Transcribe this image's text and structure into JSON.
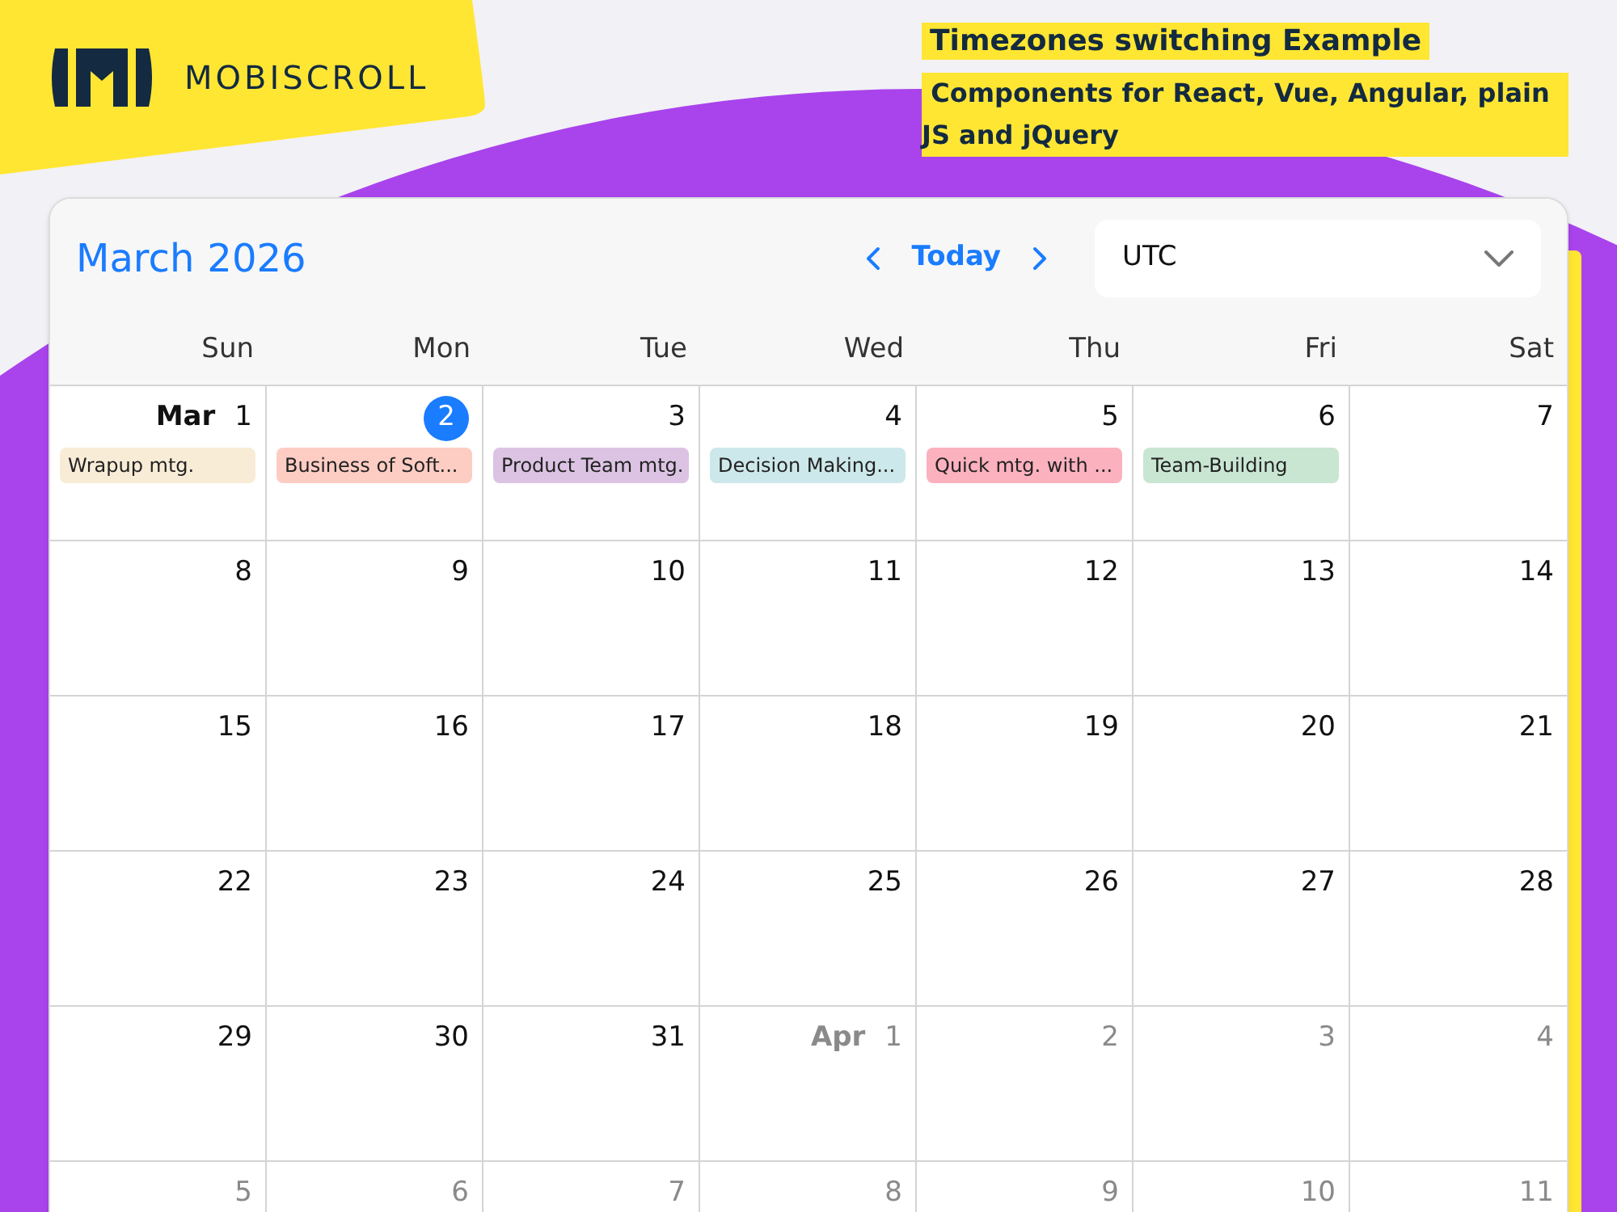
{
  "brand": {
    "name": "MOBISCROLL"
  },
  "heading": {
    "title": "Timezones switching Example",
    "subtitle": " Components for React, Vue, Angular, plain JS and jQuery"
  },
  "calendar": {
    "month": "March",
    "year": "2026",
    "today_button": "Today",
    "timezone": {
      "value": "UTC"
    },
    "weekdays": [
      "Sun",
      "Mon",
      "Tue",
      "Wed",
      "Thu",
      "Fri",
      "Sat"
    ],
    "weeks": [
      [
        {
          "month_label": "Mar",
          "day": "1",
          "outside": false,
          "selected": false,
          "events": [
            {
              "title": "Wrapup mtg.",
              "color": "#f8ecd6"
            }
          ]
        },
        {
          "day": "2",
          "outside": false,
          "selected": true,
          "events": [
            {
              "title": "Business of Soft...",
              "color": "#fdcdc3"
            }
          ]
        },
        {
          "day": "3",
          "outside": false,
          "selected": false,
          "events": [
            {
              "title": "Product Team mtg.",
              "color": "#dcc3e3"
            }
          ]
        },
        {
          "day": "4",
          "outside": false,
          "selected": false,
          "events": [
            {
              "title": "Decision Making...",
              "color": "#cde8ea"
            }
          ]
        },
        {
          "day": "5",
          "outside": false,
          "selected": false,
          "events": [
            {
              "title": "Quick mtg. with ...",
              "color": "#fbb1be"
            }
          ]
        },
        {
          "day": "6",
          "outside": false,
          "selected": false,
          "events": [
            {
              "title": "Team-Building",
              "color": "#c9e6d3"
            }
          ]
        },
        {
          "day": "7",
          "outside": false,
          "selected": false
        }
      ],
      [
        {
          "day": "8",
          "outside": false,
          "selected": false
        },
        {
          "day": "9",
          "outside": false,
          "selected": false
        },
        {
          "day": "10",
          "outside": false,
          "selected": false
        },
        {
          "day": "11",
          "outside": false,
          "selected": false
        },
        {
          "day": "12",
          "outside": false,
          "selected": false
        },
        {
          "day": "13",
          "outside": false,
          "selected": false
        },
        {
          "day": "14",
          "outside": false,
          "selected": false
        }
      ],
      [
        {
          "day": "15",
          "outside": false,
          "selected": false
        },
        {
          "day": "16",
          "outside": false,
          "selected": false
        },
        {
          "day": "17",
          "outside": false,
          "selected": false
        },
        {
          "day": "18",
          "outside": false,
          "selected": false
        },
        {
          "day": "19",
          "outside": false,
          "selected": false
        },
        {
          "day": "20",
          "outside": false,
          "selected": false
        },
        {
          "day": "21",
          "outside": false,
          "selected": false
        }
      ],
      [
        {
          "day": "22",
          "outside": false,
          "selected": false
        },
        {
          "day": "23",
          "outside": false,
          "selected": false
        },
        {
          "day": "24",
          "outside": false,
          "selected": false
        },
        {
          "day": "25",
          "outside": false,
          "selected": false
        },
        {
          "day": "26",
          "outside": false,
          "selected": false
        },
        {
          "day": "27",
          "outside": false,
          "selected": false
        },
        {
          "day": "28",
          "outside": false,
          "selected": false
        }
      ],
      [
        {
          "day": "29",
          "outside": false,
          "selected": false
        },
        {
          "day": "30",
          "outside": false,
          "selected": false
        },
        {
          "day": "31",
          "outside": false,
          "selected": false
        },
        {
          "month_label": "Apr",
          "day": "1",
          "outside": true,
          "selected": false
        },
        {
          "day": "2",
          "outside": true,
          "selected": false
        },
        {
          "day": "3",
          "outside": true,
          "selected": false
        },
        {
          "day": "4",
          "outside": true,
          "selected": false
        }
      ],
      [
        {
          "day": "5",
          "outside": true,
          "selected": false
        },
        {
          "day": "6",
          "outside": true,
          "selected": false
        },
        {
          "day": "7",
          "outside": true,
          "selected": false
        },
        {
          "day": "8",
          "outside": true,
          "selected": false
        },
        {
          "day": "9",
          "outside": true,
          "selected": false
        },
        {
          "day": "10",
          "outside": true,
          "selected": false
        },
        {
          "day": "11",
          "outside": true,
          "selected": false
        }
      ]
    ]
  }
}
